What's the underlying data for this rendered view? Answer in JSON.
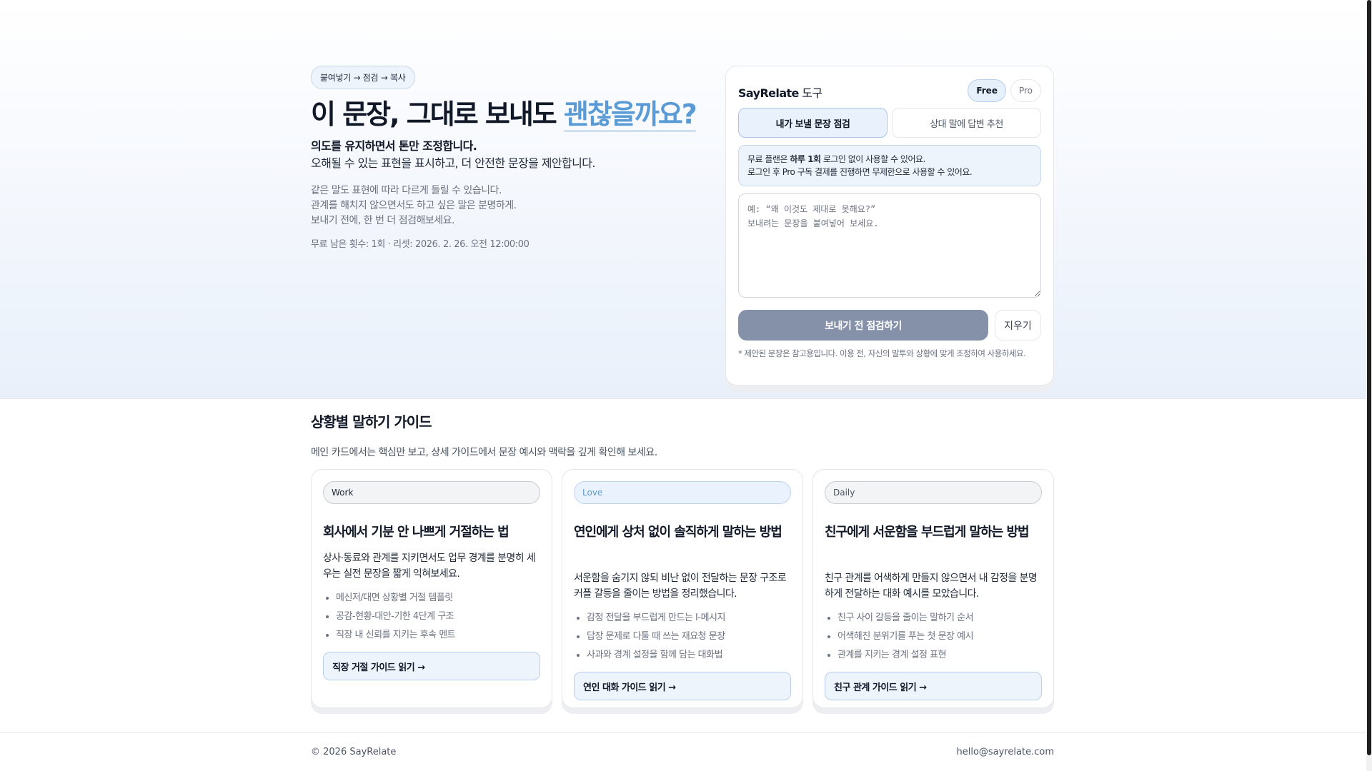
{
  "hero": {
    "steps_pill": "붙여넣기 → 점검 → 복사",
    "headline_main": "이 문장, 그대로 보내도 ",
    "headline_accent": "괜찮을까요?",
    "subhead": "의도를 유지하면서 톤만 조정합니다.",
    "subdesc": "오해될 수 있는 표현을 표시하고, 더 안전한 문장을 제안합니다.",
    "muted_lines": [
      "같은 말도 표현에 따라 다르게 들릴 수 있습니다.",
      "관계를 해치지 않으면서도 하고 싶은 말은 분명하게.",
      "보내기 전에, 한 번 더 점검해보세요."
    ],
    "counter": "무료 남은 횟수: 1회 · 리셋: 2026. 2. 26. 오전 12:00:00"
  },
  "tool": {
    "brand": "SayRelate",
    "title_suffix": " 도구",
    "plans": [
      "Free",
      "Pro"
    ],
    "active_plan": "Free",
    "tabs": [
      "내가 보낼 문장 점검",
      "상대 말에 답변 추천"
    ],
    "active_tab": 0,
    "notice_line1_prefix": "무료 플랜은 ",
    "notice_line1_bold": "하루 1회",
    "notice_line1_suffix": " 로그인 없이 사용할 수 있어요.",
    "notice_line2": "로그인 후 Pro 구독 결제를 진행하면 무제한으로 사용할 수 있어요.",
    "editor_value": "",
    "editor_placeholder": "예: “왜 이것도 제대로 못해요?”\n보내려는 문장을 붙여넣어 보세요.",
    "check_button": "보내기 전 점검하기",
    "clear_button": "지우기",
    "footnote": "* 제안된 문장은 참고용입니다. 이용 전, 자신의 말투와 상황에 맞게 조정하여 사용하세요."
  },
  "guides": {
    "title": "상황별 말하기 가이드",
    "description": "메인 카드에서는 핵심만 보고, 상세 가이드에서 문장 예시와 맥락을 깊게 확인해 보세요.",
    "cards": [
      {
        "tag": "Work",
        "title": "회사에서 기분 안 나쁘게 거절하는 법",
        "summary": "상사·동료와 관계를 지키면서도 업무 경계를 분명히 세우는 실전 문장을 짧게 익혀보세요.",
        "points": [
          "메신저/대면 상황별 거절 템플릿",
          "공감-현황-대안-기한 4단계 구조",
          "직장 내 신뢰를 지키는 후속 멘트"
        ],
        "link": "직장 거절 가이드 읽기 →"
      },
      {
        "tag": "Love",
        "title": "연인에게 상처 없이 솔직하게 말하는 방법",
        "summary": "서운함을 숨기지 않되 비난 없이 전달하는 문장 구조로 커플 갈등을 줄이는 방법을 정리했습니다.",
        "points": [
          "감정 전달을 부드럽게 만드는 I-메시지",
          "답장 문제로 다툴 때 쓰는 재요청 문장",
          "사과와 경계 설정을 함께 담는 대화법"
        ],
        "link": "연인 대화 가이드 읽기 →"
      },
      {
        "tag": "Daily",
        "title": "친구에게 서운함을 부드럽게 말하는 방법",
        "summary": "친구 관계를 어색하게 만들지 않으면서 내 감정을 분명하게 전달하는 대화 예시를 모았습니다.",
        "points": [
          "친구 사이 갈등을 줄이는 말하기 순서",
          "어색해진 분위기를 푸는 첫 문장 예시",
          "관계를 지키는 경계 설정 표현"
        ],
        "link": "친구 관계 가이드 읽기 →"
      }
    ]
  },
  "footer": {
    "copyright": "© 2026 SayRelate",
    "email": "hello@sayrelate.com"
  },
  "colors": {
    "accent": "#5b9bd5",
    "primary_button": "#8491a8",
    "notice_bg": "#eef4fc"
  }
}
